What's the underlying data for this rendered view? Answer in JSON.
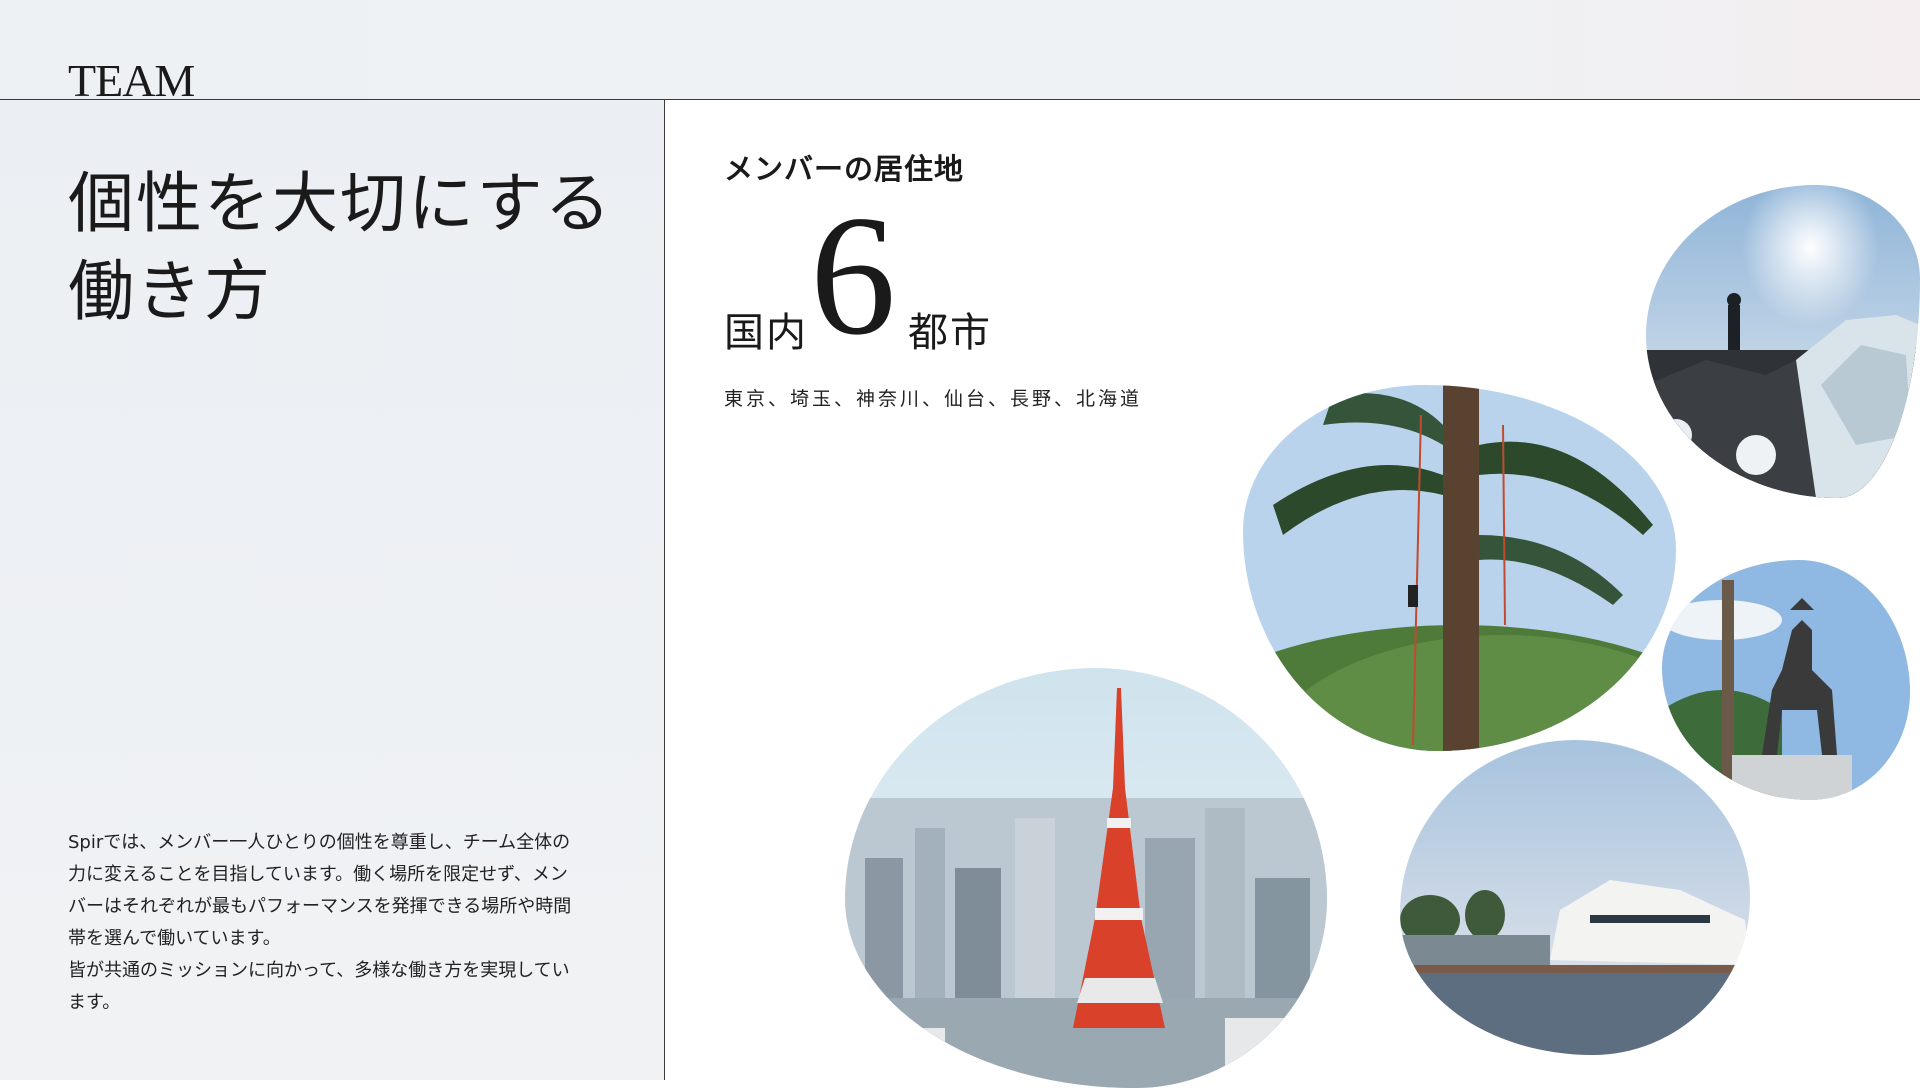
{
  "header": {
    "section_title": "TEAM"
  },
  "left": {
    "headline": [
      "個性を大切にする",
      "働き方"
    ],
    "description": [
      "Spirでは、メンバー一人ひとりの個性を尊重し、チーム全体の",
      "力に変えることを目指しています。働く場所を限定せず、メン",
      "バーはそれぞれが最もパフォーマンスを発揮できる場所や時間",
      "帯を選んで働いています。",
      "皆が共通のミッションに向かって、多様な働き方を実現してい",
      "ます。"
    ]
  },
  "stats": {
    "label": "メンバーの居住地",
    "prefix": "国内",
    "number": "6",
    "suffix": "都市",
    "cities": "東京、埼玉、神奈川、仙台、長野、北海道"
  },
  "colors": {
    "accent_line": "#3a3a3a",
    "panel_bg": "#eef1f4",
    "tower_red": "#d9412b"
  }
}
